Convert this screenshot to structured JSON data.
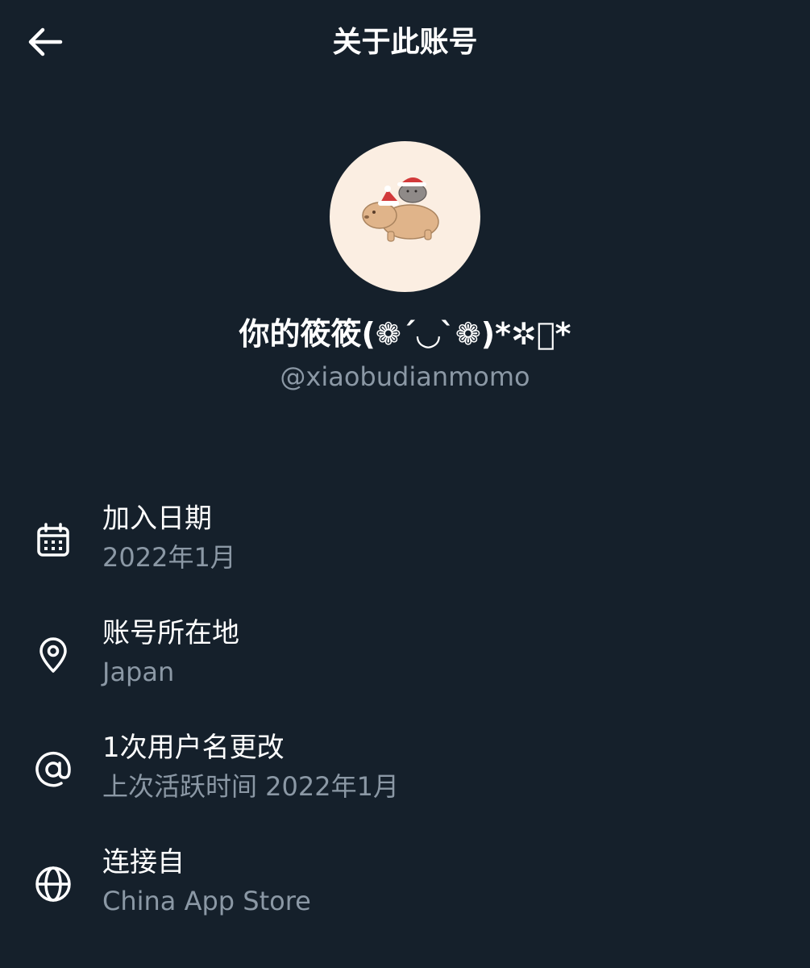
{
  "header": {
    "title": "关于此账号",
    "back_icon": "arrow-left-icon"
  },
  "profile": {
    "display_name": "你的筱筱(❁´◡`❁)*✲゚*",
    "handle": "@xiaobudianmomo"
  },
  "info": {
    "items": [
      {
        "icon": "calendar-icon",
        "title": "加入日期",
        "value": "2022年1月"
      },
      {
        "icon": "location-pin-icon",
        "title": "账号所在地",
        "value": "Japan"
      },
      {
        "icon": "at-sign-icon",
        "title": "1次用户名更改",
        "value": "上次活跃时间 2022年1月"
      },
      {
        "icon": "globe-icon",
        "title": "连接自",
        "value": "China App Store"
      }
    ]
  },
  "colors": {
    "background": "#15202b",
    "primary_text": "#ffffff",
    "secondary_text": "#8b98a5",
    "avatar_bg": "#fbeee2"
  }
}
